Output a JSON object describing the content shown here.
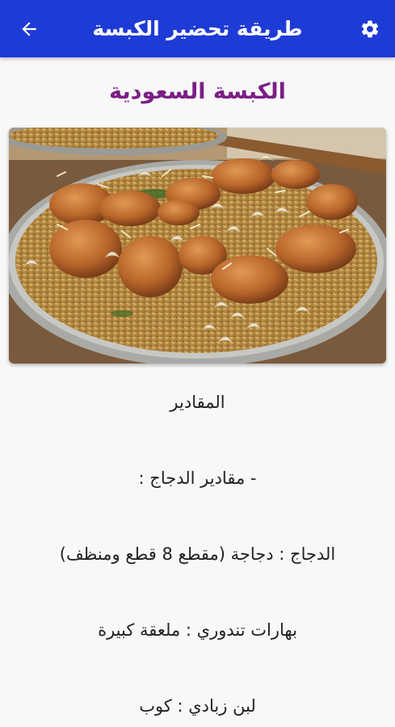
{
  "app_bar": {
    "title": "طريقة تحضير الكبسة",
    "settings_icon": "gear-icon",
    "back_icon": "arrow-left-icon",
    "color": "#1f3bd6"
  },
  "recipe": {
    "title": "الكبسة السعودية",
    "title_color": "#7b1f86",
    "lines": [
      "المقادير",
      "- مقادير الدجاج :",
      "الدجاج : دجاجة (مقطع 8 قطع ومنظف)",
      "بهارات تندوري : ملعقة كبيرة",
      "لبن زبادي : كوب"
    ]
  }
}
